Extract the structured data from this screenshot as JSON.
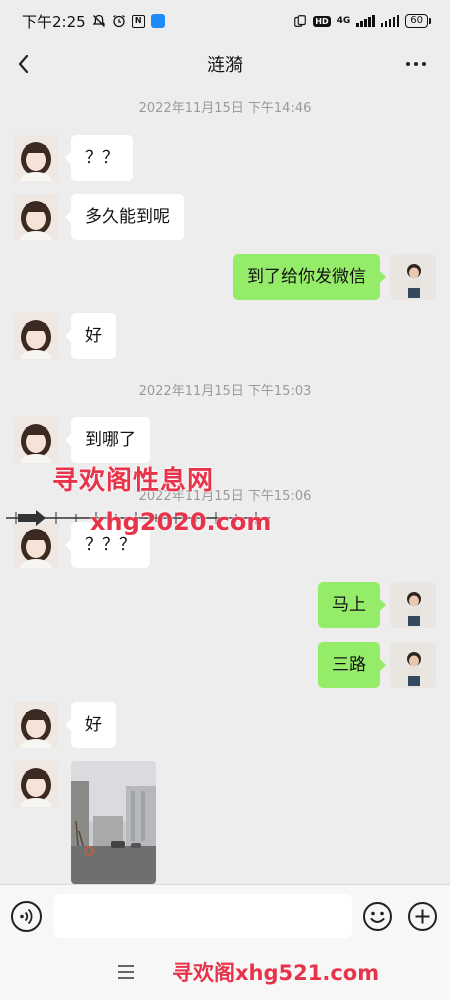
{
  "status_bar": {
    "time": "下午2:25",
    "battery": "60",
    "network": "4G",
    "hd": "HD",
    "icons": [
      "mute-icon",
      "alarm-icon",
      "nfc-icon",
      "app-notification-icon",
      "vibrate-icon",
      "hd-icon",
      "signal-icon",
      "battery-icon"
    ]
  },
  "nav": {
    "title": "涟漪",
    "back_icon": "chevron-left-icon",
    "more_icon": "more-icon"
  },
  "messages": [
    {
      "type": "timestamp",
      "text": "2022年11月15日 下午14:46"
    },
    {
      "type": "incoming",
      "text": "？？"
    },
    {
      "type": "incoming",
      "text": "多久能到呢"
    },
    {
      "type": "outgoing",
      "text": "到了给你发微信"
    },
    {
      "type": "incoming",
      "text": "好"
    },
    {
      "type": "timestamp",
      "text": "2022年11月15日 下午15:03"
    },
    {
      "type": "incoming",
      "text": "到哪了"
    },
    {
      "type": "timestamp",
      "text": "2022年11月15日 下午15:06"
    },
    {
      "type": "incoming",
      "text": "？？？"
    },
    {
      "type": "outgoing",
      "text": "马上"
    },
    {
      "type": "outgoing",
      "text": "三路"
    },
    {
      "type": "incoming",
      "text": "好"
    },
    {
      "type": "incoming_image",
      "text": ""
    }
  ],
  "watermark": {
    "title": "寻欢阁性息网",
    "url": "xhg2020.com",
    "bottom": "寻欢阁xhg521.com"
  },
  "input_bar": {
    "value": "",
    "icons": [
      "voice-icon",
      "emoji-icon",
      "plus-icon"
    ]
  },
  "system_nav": {
    "icons": [
      "menu-icon"
    ]
  },
  "colors": {
    "background": "#ededed",
    "outgoing_bubble": "#95ec69",
    "incoming_bubble": "#ffffff",
    "timestamp": "#9a9a9a",
    "watermark": "#e8344a"
  }
}
